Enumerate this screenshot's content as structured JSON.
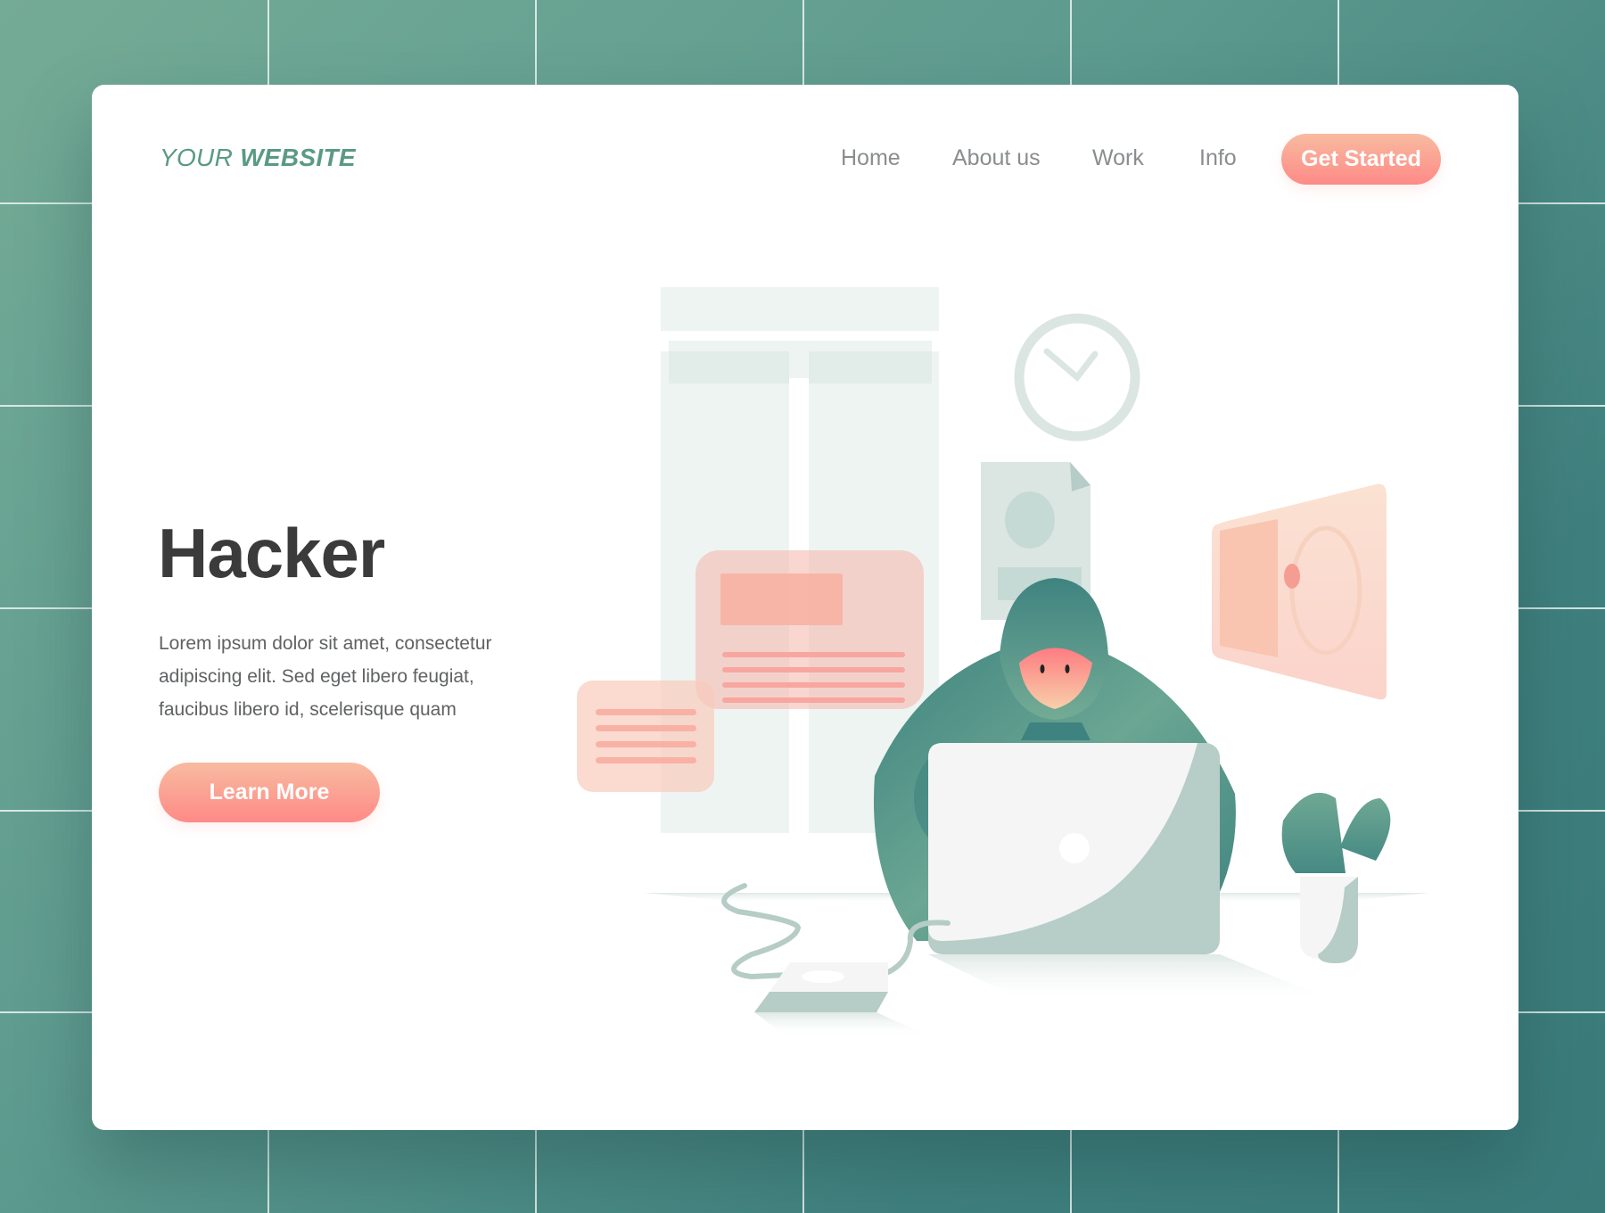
{
  "background": {
    "colors": {
      "top_left": "#74ab96",
      "bottom_right": "#3a7b7a",
      "grid_line": "#ebf5f2"
    }
  },
  "header": {
    "logo": {
      "light": "YOUR",
      "bold": "WEBSITE"
    },
    "nav": [
      {
        "label": "Home"
      },
      {
        "label": "About us"
      },
      {
        "label": "Work"
      },
      {
        "label": "Info"
      }
    ],
    "cta_label": "Get Started"
  },
  "hero": {
    "title": "Hacker",
    "description": "Lorem ipsum dolor sit amet, consectetur adipiscing elit. Sed eget libero feugiat, faucibus libero id, scelerisque quam",
    "button_label": "Learn More"
  },
  "illustration": {
    "subject": "hooded hacker at laptop",
    "elements": [
      "wireframe-panels",
      "clock-icon",
      "document-icon",
      "safe-icon",
      "chat-card",
      "text-card",
      "laptop",
      "hard-drive",
      "cactus-plant"
    ]
  },
  "colors": {
    "brand_green": "#5a9a84",
    "accent_coral": "#fe8a87",
    "accent_peach": "#f8bba0",
    "title_text": "#3b3b3b",
    "body_text": "#5f6163",
    "nav_text": "#8a8d8f"
  }
}
